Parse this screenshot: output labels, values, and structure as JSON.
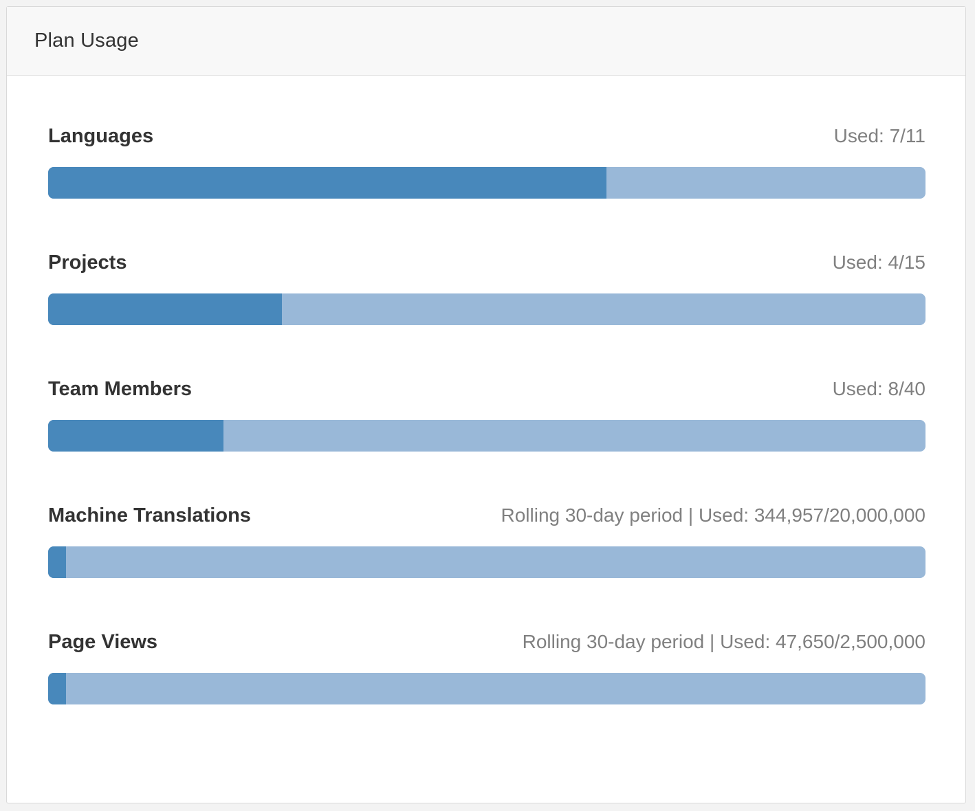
{
  "panel": {
    "title": "Plan Usage"
  },
  "usage": [
    {
      "label": "Languages",
      "value_text": "Used: 7/11",
      "used": 7,
      "limit": 11
    },
    {
      "label": "Projects",
      "value_text": "Used: 4/15",
      "used": 4,
      "limit": 15
    },
    {
      "label": "Team Members",
      "value_text": "Used: 8/40",
      "used": 8,
      "limit": 40
    },
    {
      "label": "Machine Translations",
      "value_text": "Rolling 30-day period | Used: 344,957/20,000,000",
      "used": 344957,
      "limit": 20000000
    },
    {
      "label": "Page Views",
      "value_text": "Rolling 30-day period | Used: 47,650/2,500,000",
      "used": 47650,
      "limit": 2500000
    }
  ],
  "colors": {
    "bar_fill": "#4888bb",
    "bar_track": "#99b8d8",
    "label_text": "#333333",
    "value_text": "#808080"
  }
}
